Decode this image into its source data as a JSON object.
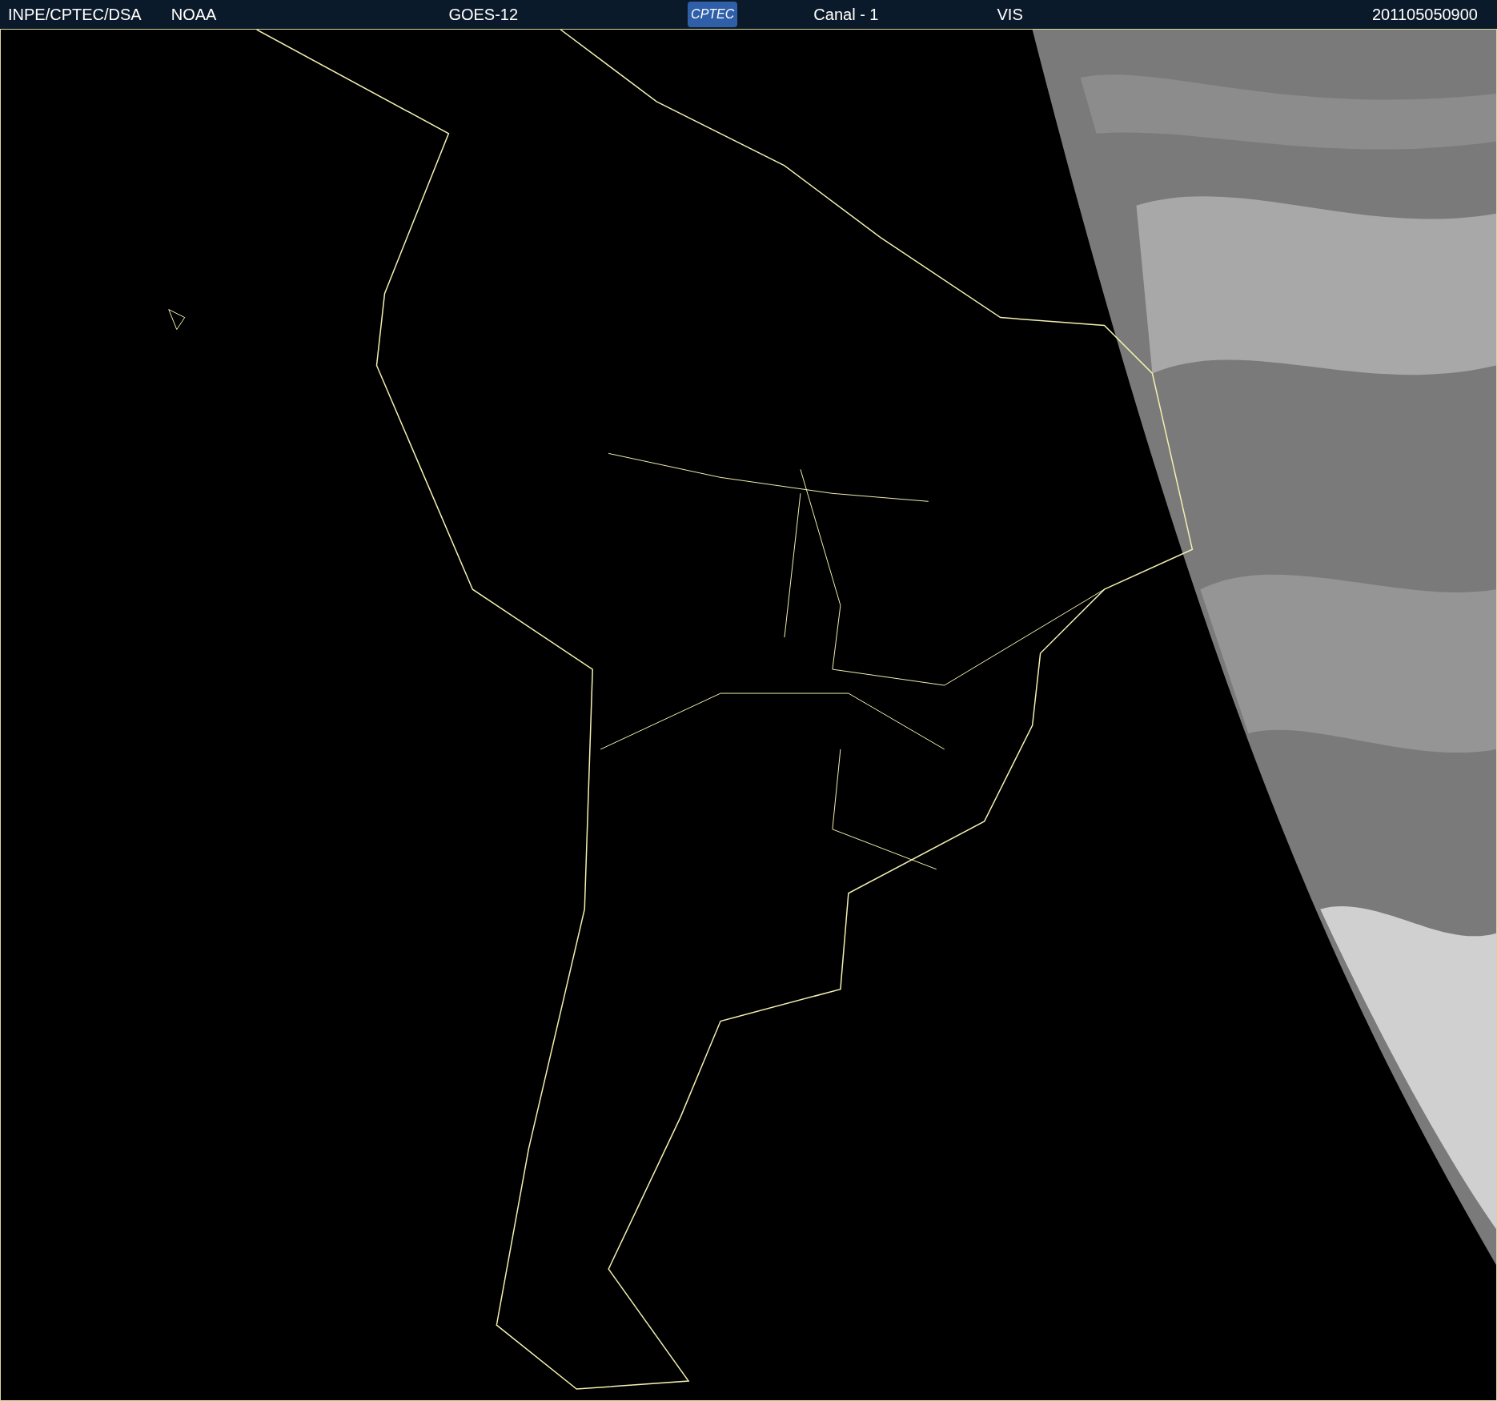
{
  "header": {
    "agency": "INPE/CPTEC/DSA",
    "source": "NOAA",
    "satellite": "GOES-12",
    "logo": "CPTEC",
    "channel": "Canal - 1",
    "band": "VIS",
    "timestamp": "201105050900"
  }
}
